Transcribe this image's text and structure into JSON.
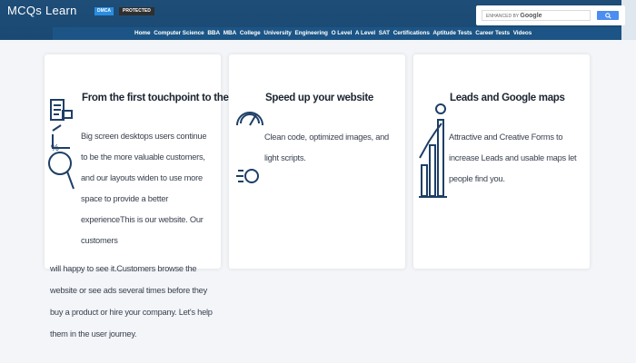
{
  "header": {
    "logo": "MCQs Learn",
    "badge_left": "DMCA",
    "badge_right": "PROTECTED",
    "search": {
      "enhanced_by": "ENHANCED BY",
      "google": "Google",
      "button_icon": "search-icon"
    },
    "nav": [
      "Home",
      "Computer Science",
      "BBA",
      "MBA",
      "College",
      "University",
      "Engineering",
      "O Level",
      "A Level",
      "SAT",
      "Certifications",
      "Aptitude Tests",
      "Career Tests",
      "Videos"
    ]
  },
  "cards": [
    {
      "title": "From the first touchpoint to the sale",
      "text_in_card": "Big screen desktops users continue to be the more valuable customers, and our layouts widen to use more space to provide a better experienceThis is our website. Our customers",
      "text_overflow": "will happy to see it.Customers browse the website or see ads several times before they buy a product or hire your company. Let's help them in the user journey.",
      "icon": "analytics-icon"
    },
    {
      "title": "Speed up your website",
      "text": "Clean code, optimized images, and light scripts.",
      "icon": "speedometer-icon"
    },
    {
      "title": "Leads and Google maps",
      "text": "Attractive and Creative Forms to increase Leads and usable maps let people find you.",
      "icon": "growth-chart-icon"
    }
  ],
  "colors": {
    "header": "#1a4a74",
    "icon": "#1e3f66",
    "background": "#f3f5f8"
  }
}
